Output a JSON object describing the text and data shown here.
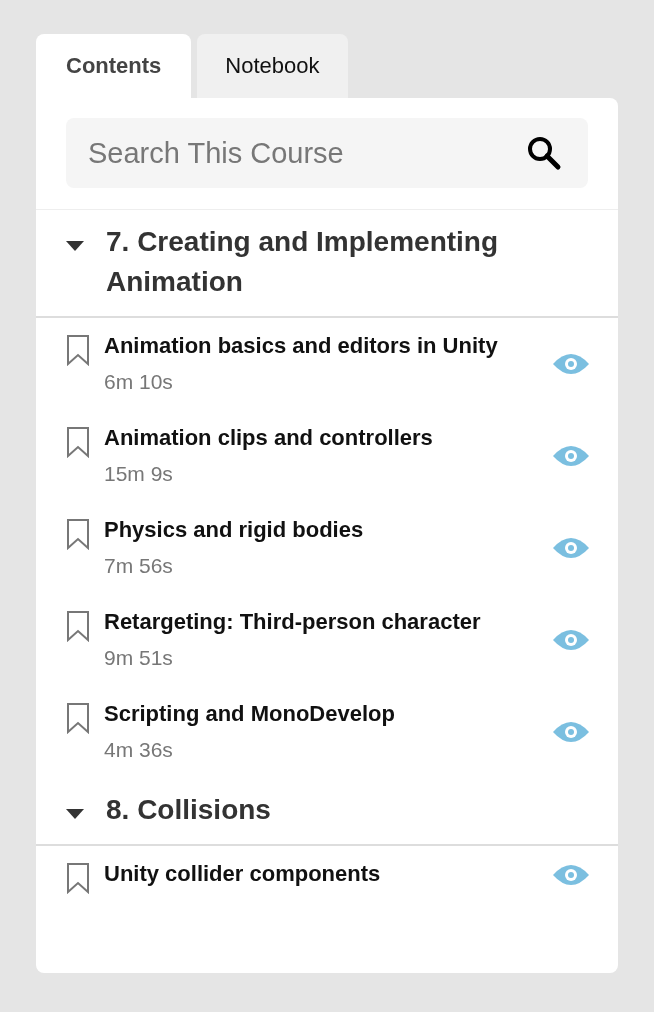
{
  "tabs": [
    {
      "label": "Contents",
      "selected": true
    },
    {
      "label": "Notebook",
      "selected": false
    }
  ],
  "search": {
    "placeholder": "Search This Course"
  },
  "sections": [
    {
      "title": "7. Creating and Implementing Animation",
      "expanded": true,
      "items": [
        {
          "title": "Animation basics and editors in Unity",
          "duration": "6m 10s"
        },
        {
          "title": "Animation clips and controllers",
          "duration": "15m 9s"
        },
        {
          "title": "Physics and rigid bodies",
          "duration": "7m 56s"
        },
        {
          "title": "Retargeting: Third-person character",
          "duration": "9m 51s"
        },
        {
          "title": "Scripting and MonoDevelop",
          "duration": "4m 36s"
        }
      ]
    },
    {
      "title": "8. Collisions",
      "expanded": true,
      "items": [
        {
          "title": "Unity collider components"
        }
      ]
    }
  ]
}
